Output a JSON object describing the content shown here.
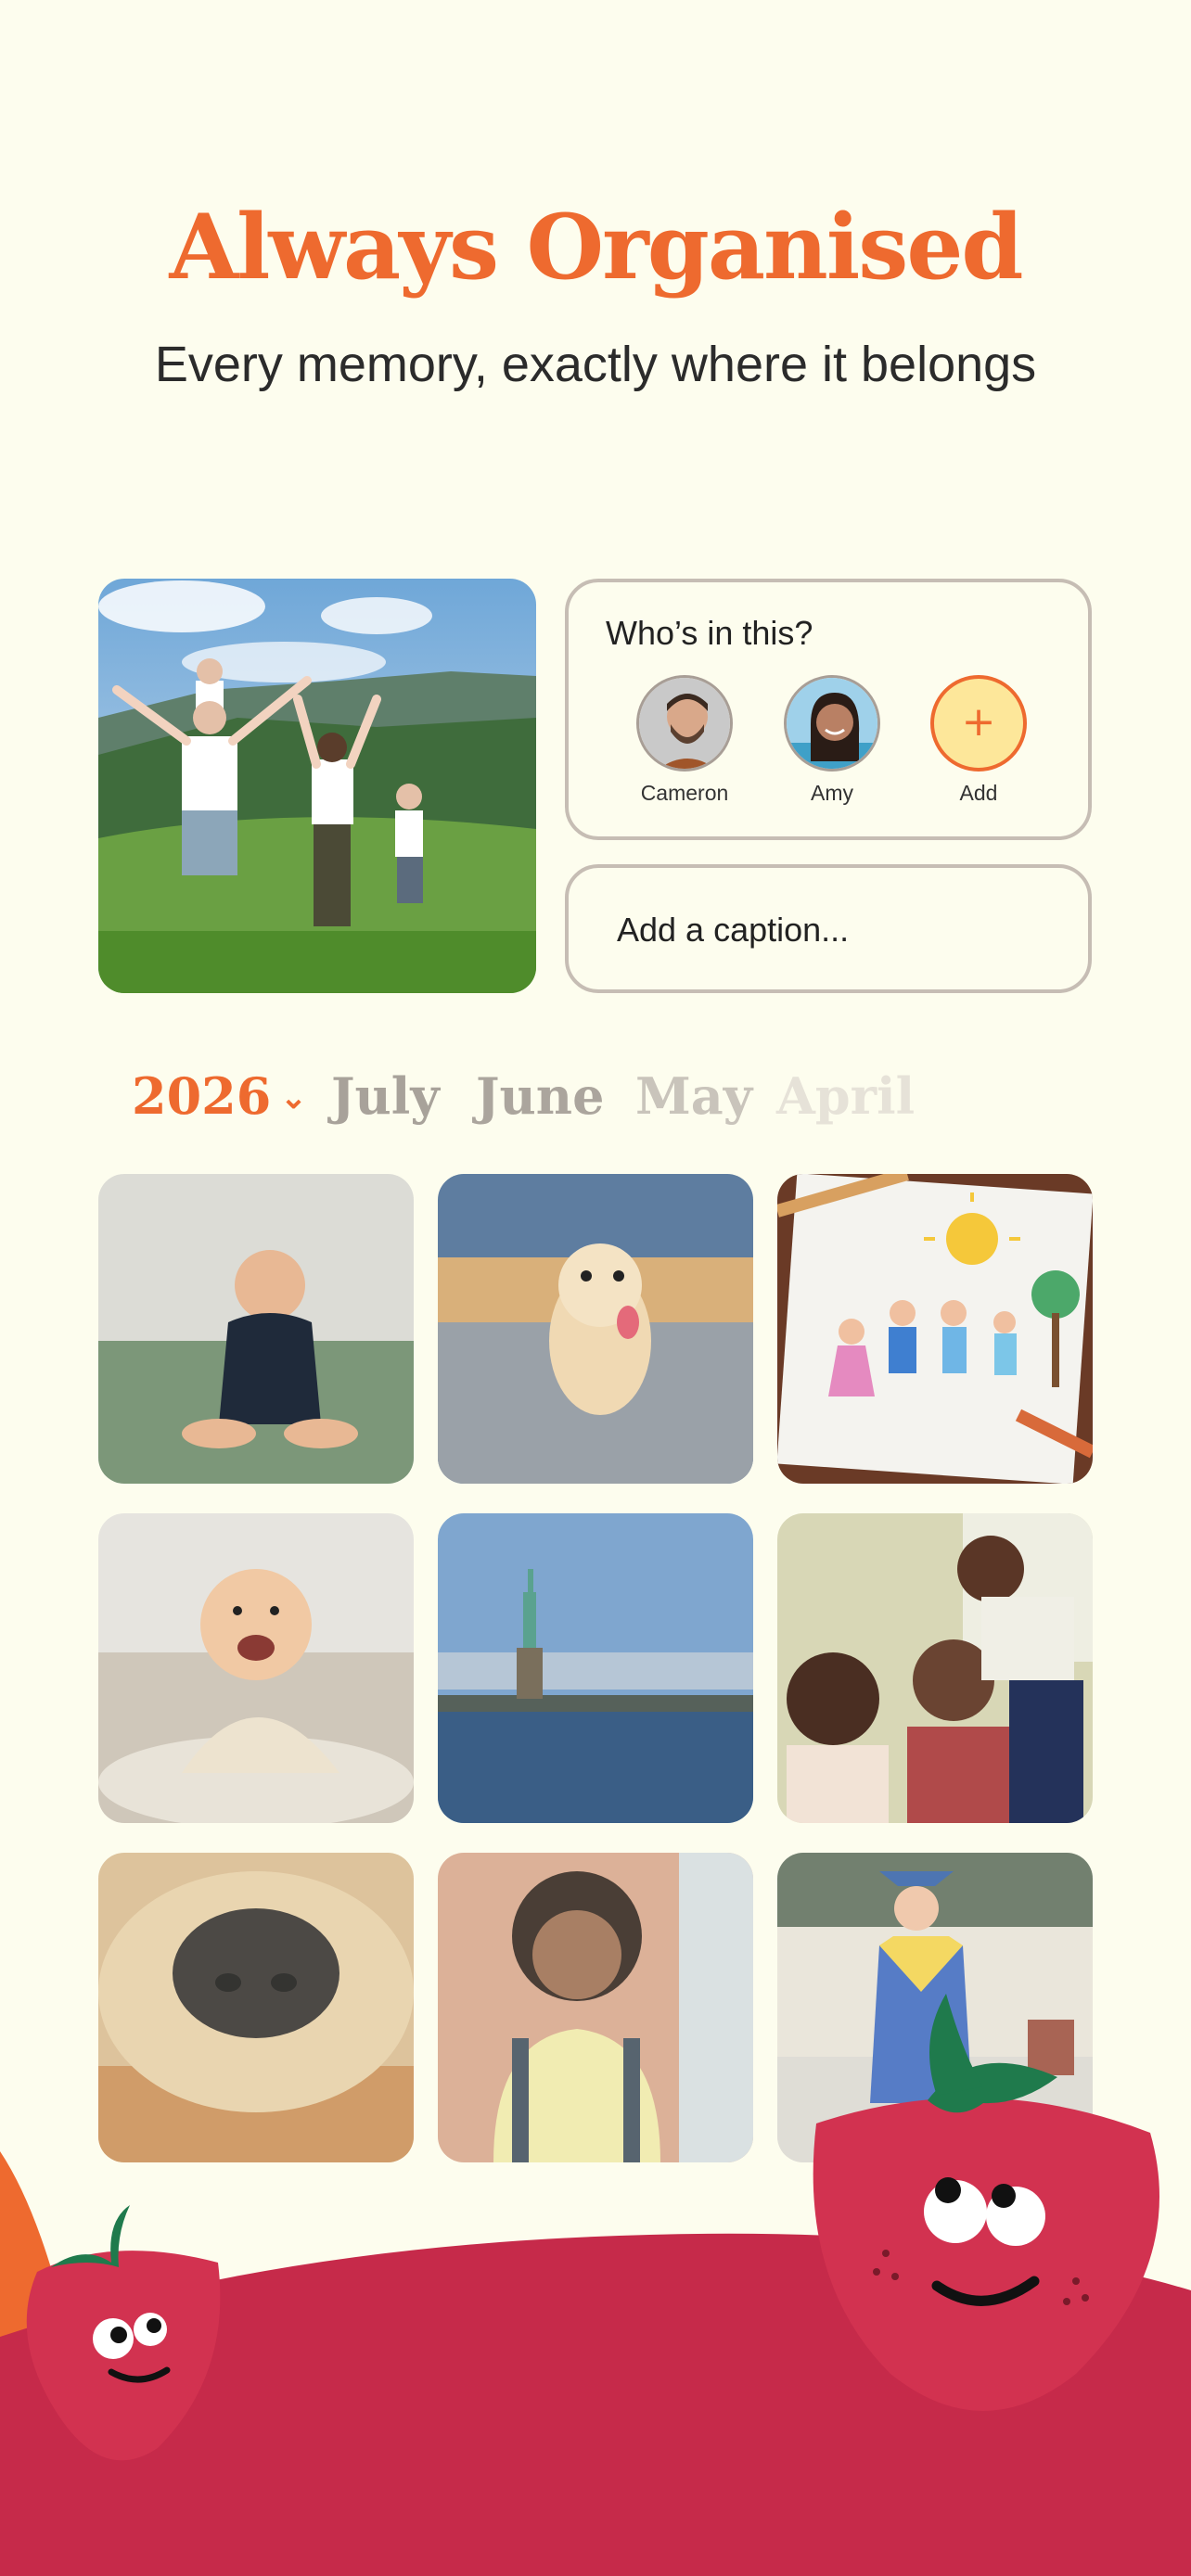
{
  "header": {
    "title": "Always Organised",
    "subtitle": "Every memory, exactly where it belongs"
  },
  "tagging": {
    "question": "Who’s in this?",
    "people": [
      {
        "name": "Cameron"
      },
      {
        "name": "Amy"
      }
    ],
    "add_label": "Add",
    "add_symbol": "+"
  },
  "caption": {
    "placeholder": "Add a caption..."
  },
  "timeline": {
    "year": "2026",
    "months": [
      "July",
      "June",
      "May",
      "April"
    ]
  },
  "colors": {
    "accent": "#ee6a2f",
    "strawberry": "#c62a4a",
    "background": "#fdfdee"
  }
}
